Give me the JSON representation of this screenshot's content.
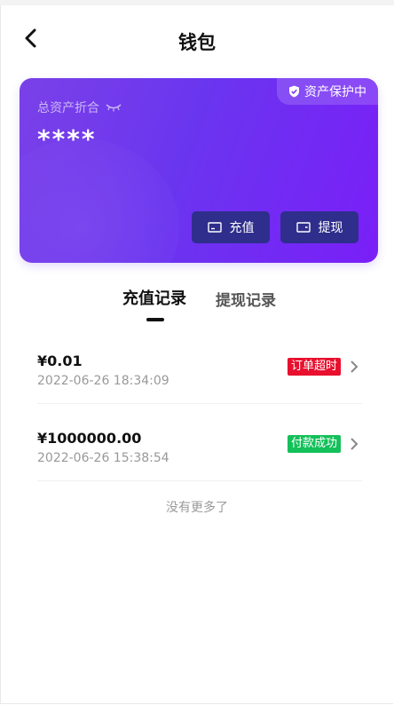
{
  "header": {
    "title": "钱包"
  },
  "card": {
    "protect_label": "资产保护中",
    "asset_label": "总资产折合",
    "asset_value": "****",
    "recharge_label": "充值",
    "withdraw_label": "提现",
    "colors": {
      "gradient_start": "#7a41e8",
      "gradient_end": "#7a1ff8",
      "button_bg": "#2f2e8c"
    }
  },
  "tabs": [
    {
      "label": "充值记录",
      "active": true
    },
    {
      "label": "提现记录",
      "active": false
    }
  ],
  "records": [
    {
      "amount": "¥0.01",
      "time": "2022-06-26 18:34:09",
      "status": "订单超时",
      "status_color": "#e8102e"
    },
    {
      "amount": "¥1000000.00",
      "time": "2022-06-26 15:38:54",
      "status": "付款成功",
      "status_color": "#14c05a"
    }
  ],
  "footer": {
    "no_more": "没有更多了"
  }
}
